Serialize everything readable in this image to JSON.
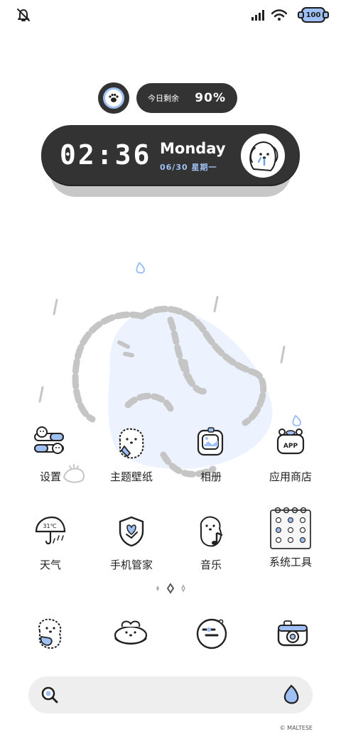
{
  "status_bar": {
    "battery": "100"
  },
  "battery_widget": {
    "label": "今日剩余",
    "value": "90%"
  },
  "clock_widget": {
    "time": "02:36",
    "day": "Monday",
    "date": "06/30 星期一"
  },
  "apps_row1": [
    {
      "label": "设置",
      "icon": "settings-icon"
    },
    {
      "label": "主题壁纸",
      "icon": "theme-wallpaper-icon"
    },
    {
      "label": "相册",
      "icon": "gallery-icon"
    },
    {
      "label": "应用商店",
      "icon": "app-store-icon"
    }
  ],
  "apps_row2": [
    {
      "label": "天气",
      "icon": "weather-icon"
    },
    {
      "label": "手机管家",
      "icon": "phone-manager-icon"
    },
    {
      "label": "音乐",
      "icon": "music-icon"
    },
    {
      "label": "系统工具",
      "icon": "system-tools-icon"
    }
  ],
  "weather_icon_text": "31℃",
  "app_store_icon_text": "APP",
  "dock": [
    "phone-icon",
    "messages-icon",
    "browser-icon",
    "camera-icon"
  ],
  "watermark": "© MALTESE",
  "colors": {
    "accent": "#9ec0f4",
    "widget_bg": "#333333"
  }
}
